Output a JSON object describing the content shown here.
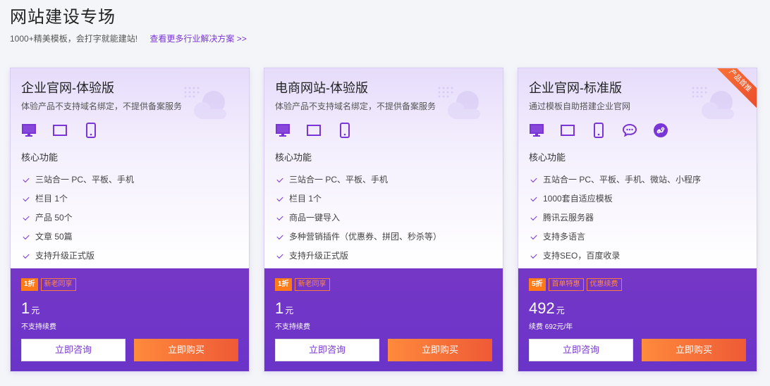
{
  "header": {
    "title": "网站建设专场",
    "subtitle": "1000+精美模板，会打字就能建站!",
    "more_link": "查看更多行业解决方案 >>"
  },
  "core_label": "核心功能",
  "colors": {
    "accent": "#7a35d6",
    "bottom": "#6a34c9",
    "buy": "#ee5a36",
    "tag": "#ff7a18"
  },
  "cards": [
    {
      "name": "企业官网-体验版",
      "desc": "体验产品不支持域名绑定，不提供备案服务",
      "devices": [
        "desktop-icon",
        "tablet-landscape-icon",
        "phone-icon"
      ],
      "features": [
        "三站合一 PC、平板、手机",
        "栏目 1个",
        "产品 50个",
        "文章 50篇",
        "支持升级正式版"
      ],
      "discount": "1折",
      "tags": [
        "新老同享"
      ],
      "price": "1",
      "unit": "元",
      "renew": "不支持续费",
      "consult": "立即咨询",
      "buy": "立即购买"
    },
    {
      "name": "电商网站-体验版",
      "desc": "体验产品不支持域名绑定，不提供备案服务",
      "devices": [
        "desktop-icon",
        "tablet-landscape-icon",
        "phone-icon"
      ],
      "features": [
        "三站合一 PC、平板、手机",
        "栏目 1个",
        "商品一键导入",
        "多种营销插件（优惠券、拼团、秒杀等）",
        "支持升级正式版"
      ],
      "discount": "1折",
      "tags": [
        "新老同享"
      ],
      "price": "1",
      "unit": "元",
      "renew": "不支持续费",
      "consult": "立即咨询",
      "buy": "立即购买"
    },
    {
      "name": "企业官网-标准版",
      "desc": "通过模板自助搭建企业官网",
      "devices": [
        "desktop-icon",
        "tablet-landscape-icon",
        "phone-icon",
        "wechat-icon",
        "mini-program-icon"
      ],
      "features": [
        "五站合一 PC、平板、手机、微站、小程序",
        "1000套自适应模板",
        "腾讯云服务器",
        "支持多语言",
        "支持SEO，百度收录"
      ],
      "discount": "5折",
      "tags": [
        "首单特惠",
        "优惠续费"
      ],
      "price": "492",
      "unit": "元",
      "renew": "续费 692元/年",
      "ribbon": "产品首推",
      "consult": "立即咨询",
      "buy": "立即购买"
    }
  ]
}
